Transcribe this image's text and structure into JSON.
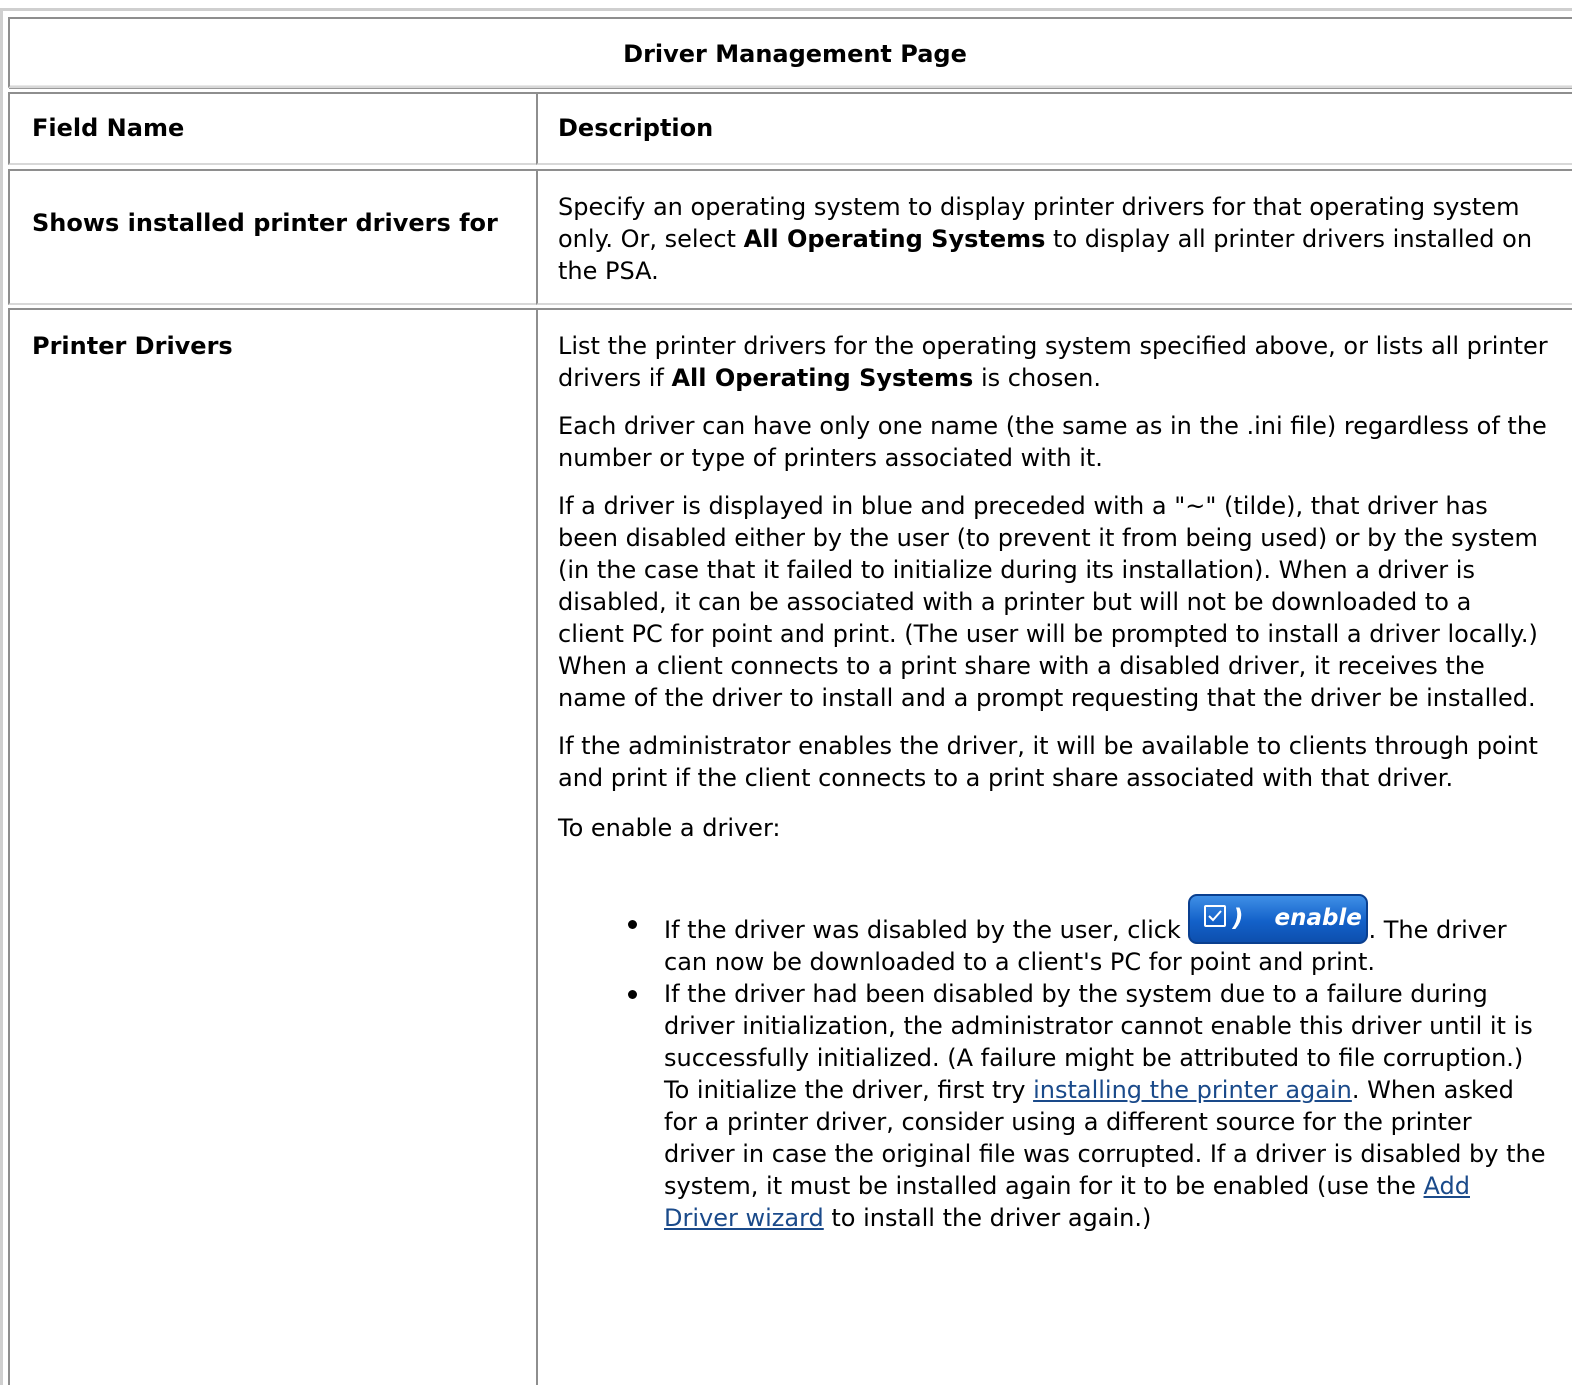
{
  "title": "Driver Management Page",
  "headers": {
    "field": "Field Name",
    "description": "Description"
  },
  "rows": {
    "shows": {
      "field": "Shows installed printer drivers for",
      "desc_before": "Specify an operating system to display printer drivers for that operating system only. Or, select ",
      "desc_bold": "All Operating Systems",
      "desc_after": " to display all printer drivers installed on the PSA."
    },
    "drivers": {
      "field": "Printer Drivers",
      "p1_before": "List the printer drivers for the operating system specified above, or lists all printer drivers if ",
      "p1_bold": "All Operating Systems",
      "p1_after": " is chosen.",
      "p2": "Each driver can have only one name (the same as in the .ini file) regardless of the number or type of printers associated with it.",
      "p3": "If a driver is displayed in blue and preceded with a \"~\" (tilde), that driver has been disabled either by the user (to prevent it from being used) or by the system (in the case that it failed to initialize during its installation). When a driver is disabled, it can be associated with a printer but will not be downloaded to a client PC for point and print. (The user will be prompted to install a driver locally.) When a client connects to a print share with a disabled driver, it receives the name of the driver to install and a prompt requesting that the driver be installed.",
      "p4": "If the administrator enables the driver, it will be available to clients through point and print if the client connects to a print share associated with that driver.",
      "p5": "To enable a driver:",
      "bullet1_before": "If the driver was disabled by the user, click ",
      "bullet1_after": ". The driver can now be downloaded to a client's PC for point and print.",
      "enable_button_label": "enable",
      "bullet2_part1": "If the driver had been disabled by the system due to a failure during driver initialization, the administrator cannot enable this driver until it is successfully initialized. (A failure might be attributed to file corruption.) To initialize the driver, first try ",
      "bullet2_link1": "installing the printer again",
      "bullet2_part2": ". When asked for a printer driver, consider using a different source for the printer driver in case the original file was corrupted. If a driver is disabled by the system, it must be installed again for it to be enabled (use the ",
      "bullet2_link2": "Add Driver wizard",
      "bullet2_part3": " to install the driver again.)"
    }
  },
  "colors": {
    "link": "#1a4a8a",
    "button": "#1361c9"
  }
}
